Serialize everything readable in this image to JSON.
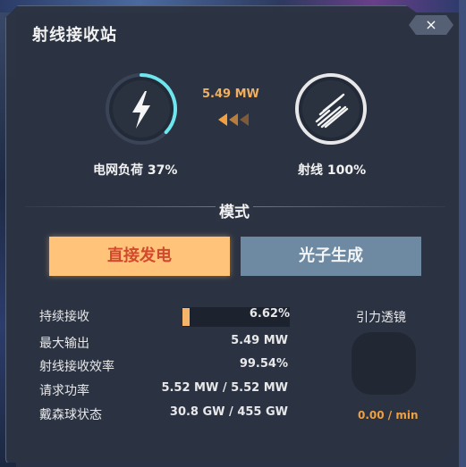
{
  "window": {
    "title": "射线接收站",
    "close_label": "×"
  },
  "power_gauge": {
    "label": "电网负荷 37%",
    "level": 0.37,
    "icon": "lightning-bolt-icon"
  },
  "ray_gauge": {
    "label": "射线 100%",
    "level": 1.0,
    "icon": "ray-stripes-icon"
  },
  "flow": {
    "value": "5.49 MW"
  },
  "mode": {
    "title": "模式",
    "options": [
      {
        "label": "直接发电",
        "selected": true
      },
      {
        "label": "光子生成",
        "selected": false
      }
    ]
  },
  "stats": [
    {
      "label": "持续接收",
      "value": "6.62%",
      "fill": 0.0662
    },
    {
      "label": "最大输出",
      "value": "5.49 MW"
    },
    {
      "label": "射线接收效率",
      "value": "99.54%"
    },
    {
      "label": "请求功率",
      "value": "5.52 MW / 5.52 MW"
    },
    {
      "label": "戴森球状态",
      "value": "30.8 GW / 455 GW"
    }
  ],
  "lens": {
    "title": "引力透镜",
    "rate": "0.00 / min"
  },
  "colors": {
    "accent_orange": "#ffc47a",
    "accent_cyan": "#7ce8f0",
    "panel": "#2c3342"
  }
}
